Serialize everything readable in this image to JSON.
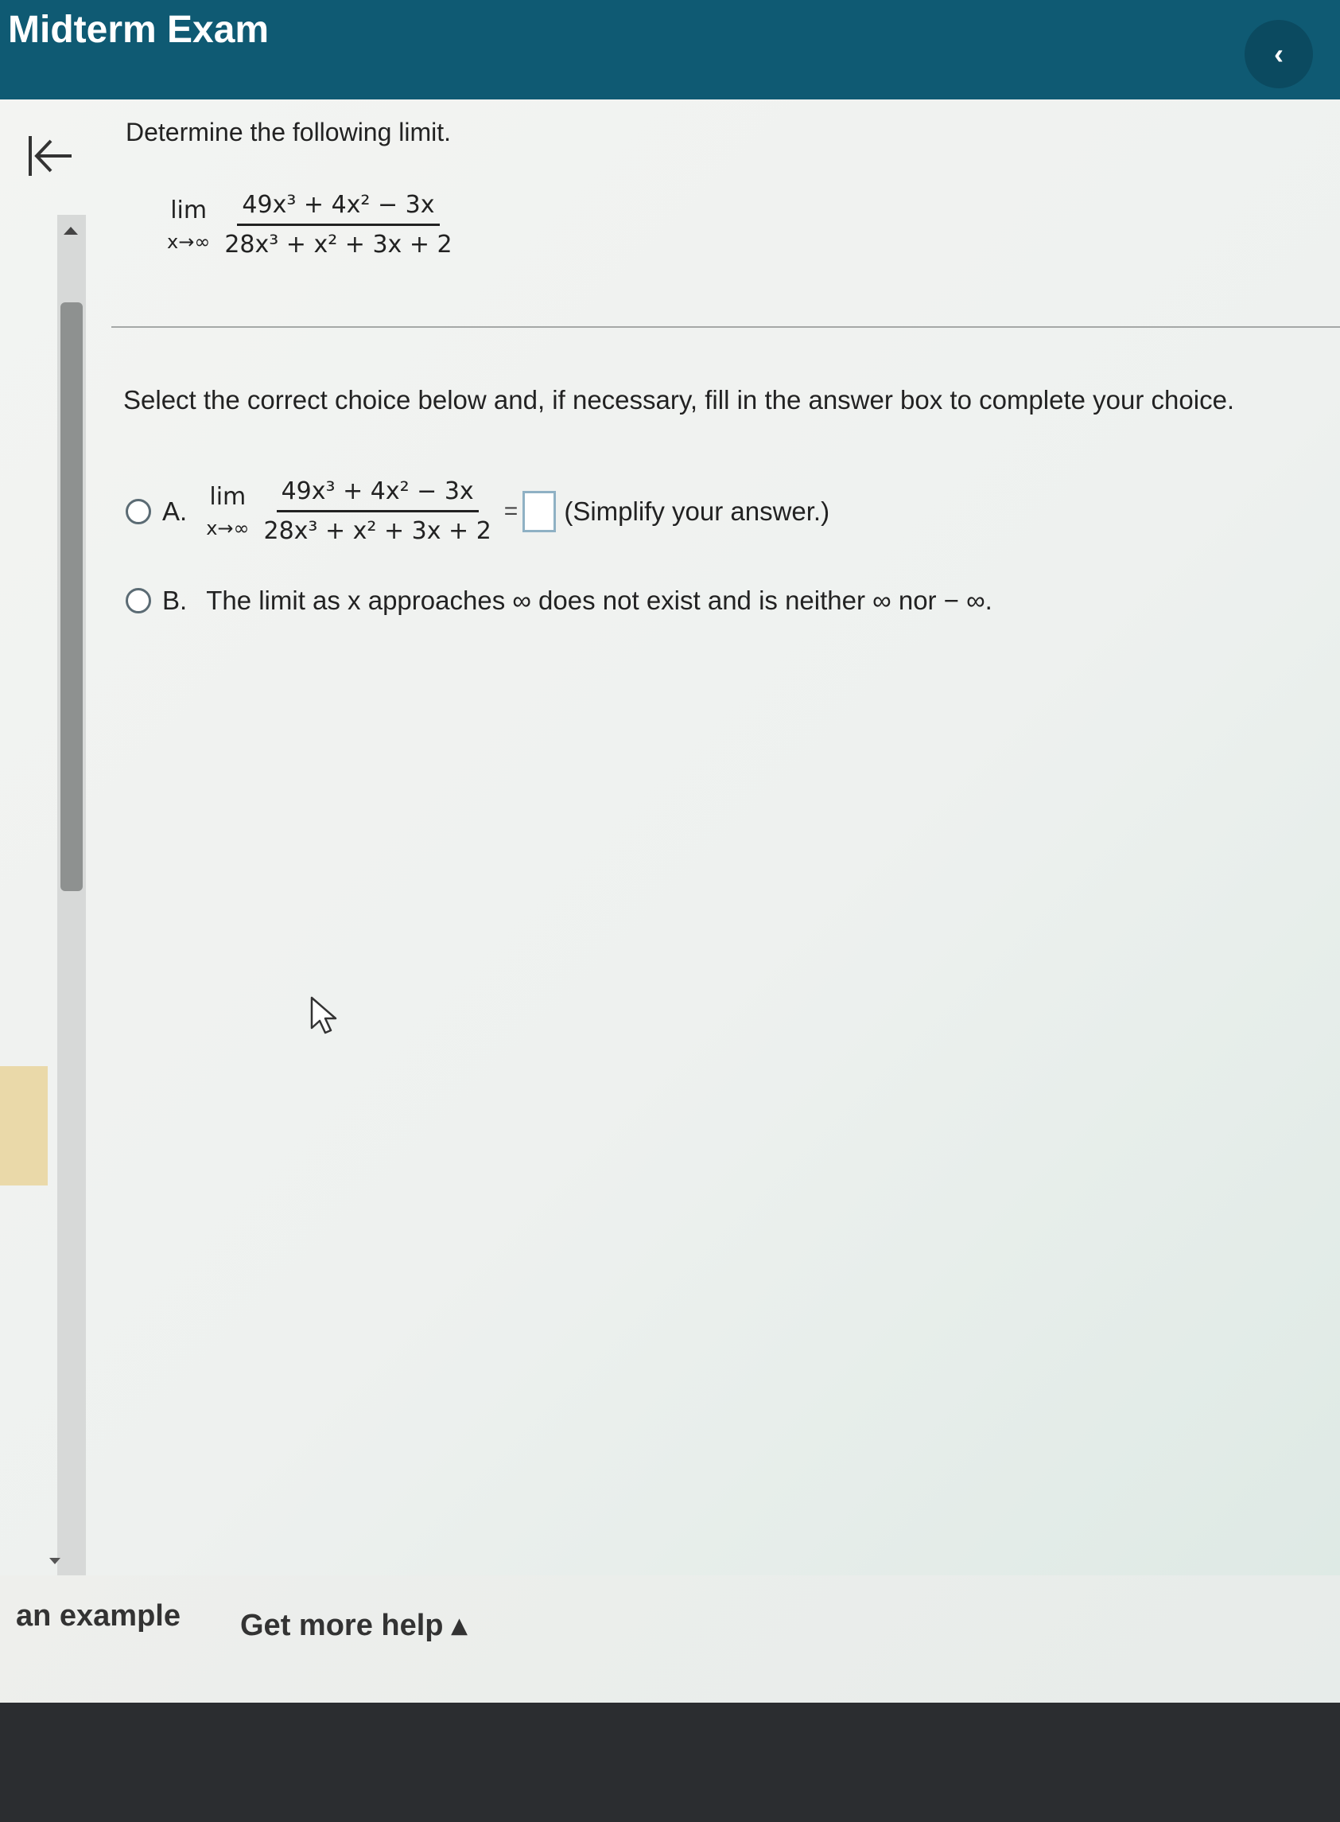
{
  "header": {
    "title": "Midterm Exam",
    "collapse_glyph": "‹"
  },
  "question": {
    "prompt": "Determine the following limit.",
    "limit": {
      "lim": "lim",
      "approach": "x→∞",
      "numerator": "49x³ + 4x² − 3x",
      "denominator": "28x³ + x² + 3x + 2"
    }
  },
  "instruction": "Select the correct choice below and, if necessary, fill in the answer box to complete your choice.",
  "choices": [
    {
      "letter": "A.",
      "equals": "=",
      "answer_value": "",
      "hint": "(Simplify your answer.)"
    },
    {
      "letter": "B.",
      "text": "The limit as x approaches ∞ does not exist and is neither ∞ nor − ∞."
    }
  ],
  "footer": {
    "example_label": "an example",
    "help_label": "Get more help ▴"
  },
  "icons": {
    "back": "collapse-left-icon",
    "collapse": "chevron-left-icon",
    "cursor": "mouse-pointer-icon"
  },
  "colors": {
    "header_bg": "#0f5a73",
    "answer_box_border": "#8fb1c4"
  }
}
